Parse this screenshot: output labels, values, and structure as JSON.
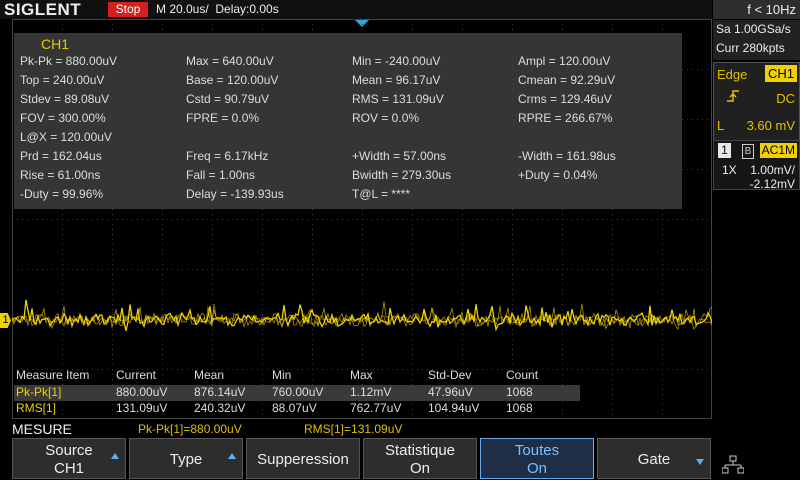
{
  "header": {
    "brand": "SIGLENT",
    "run_state": "Stop",
    "timebase": "M 20.0us/  Delay:0.00s",
    "freq_counter": "f < 10Hz"
  },
  "acquisition": {
    "sample_rate": "Sa 1.00GSa/s",
    "memory": "Curr 280kpts"
  },
  "trigger": {
    "type": "Edge",
    "source": "CH1",
    "coupling": "DC",
    "level_label": "L",
    "level": "3.60 mV"
  },
  "channel": {
    "number": "1",
    "bw_limit": "B",
    "coupling": "AC1M",
    "probe": "1X",
    "vdiv": "1.00mV/",
    "offset": "-2.12mV"
  },
  "measurements": {
    "title": "CH1",
    "rows": [
      [
        "Pk-Pk = 880.00uV",
        "Max = 640.00uV",
        "Min = -240.00uV",
        "Ampl = 120.00uV"
      ],
      [
        "Top = 240.00uV",
        "Base = 120.00uV",
        "Mean = 96.17uV",
        "Cmean = 92.29uV"
      ],
      [
        "Stdev = 89.08uV",
        "Cstd = 90.79uV",
        "RMS = 131.09uV",
        "Crms = 129.46uV"
      ],
      [
        "FOV = 300.00%",
        "FPRE = 0.0%",
        "ROV = 0.0%",
        "RPRE = 266.67%"
      ],
      [
        "L@X = 120.00uV",
        "",
        "",
        ""
      ],
      [
        "Prd = 162.04us",
        "Freq = 6.17kHz",
        "+Width = 57.00ns",
        "-Width = 161.98us"
      ],
      [
        "Rise = 61.00ns",
        "Fall = 1.00ns",
        "Bwidth = 279.30us",
        "+Duty = 0.04%"
      ],
      [
        "-Duty = 99.96%",
        "Delay = -139.93us",
        "T@L = ****",
        ""
      ]
    ]
  },
  "statistics": {
    "headers": [
      "Measure Item",
      "Current",
      "Mean",
      "Min",
      "Max",
      "Std-Dev",
      "Count"
    ],
    "rows": [
      [
        "Pk-Pk[1]",
        "880.00uV",
        "876.14uV",
        "760.00uV",
        "1.12mV",
        "47.96uV",
        "1068"
      ],
      [
        "RMS[1]",
        "131.09uV",
        "240.32uV",
        "88.07uV",
        "762.77uV",
        "104.94uV",
        "1068"
      ]
    ]
  },
  "trace": {
    "marker": "1"
  },
  "mesure_bar": {
    "label": "MESURE",
    "v1": "Pk-Pk[1]=880.00uV",
    "v2": "RMS[1]=131.09uV"
  },
  "softkeys": [
    {
      "line1": "Source",
      "line2": "CH1"
    },
    {
      "line1": "Type",
      "line2": ""
    },
    {
      "line1": "Supperession",
      "line2": ""
    },
    {
      "line1": "Statistique",
      "line2": "On"
    },
    {
      "line1": "Toutes",
      "line2": "On"
    },
    {
      "line1": "Gate",
      "line2": ""
    }
  ],
  "colors": {
    "trace": "#f0d000",
    "accent": "#2ba6e0",
    "stop": "#d42020"
  }
}
